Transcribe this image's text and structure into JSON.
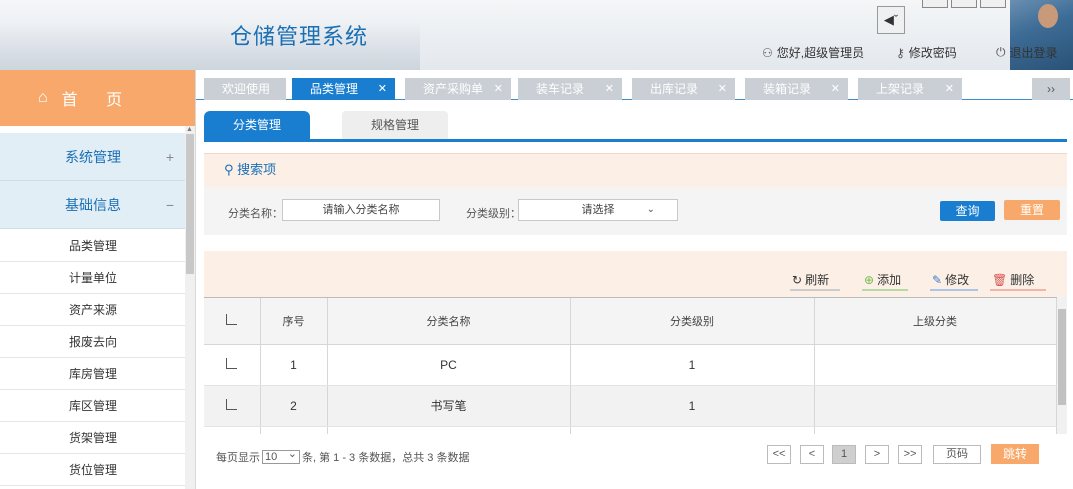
{
  "header": {
    "app_title": "仓储管理系统",
    "user_label": "您好,超级管理员",
    "change_password": "修改密码",
    "logout": "退出登录"
  },
  "sidebar": {
    "home": "首 页",
    "groups": [
      {
        "label": "系统管理",
        "toggle": "+"
      },
      {
        "label": "基础信息",
        "toggle": "−"
      }
    ],
    "items": [
      "品类管理",
      "计量单位",
      "资产来源",
      "报废去向",
      "库房管理",
      "库区管理",
      "货架管理",
      "货位管理"
    ]
  },
  "tabs": [
    {
      "label": "欢迎使用",
      "close": ""
    },
    {
      "label": "品类管理",
      "close": "✕"
    },
    {
      "label": "资产采购单",
      "close": "✕"
    },
    {
      "label": "装车记录",
      "close": "✕"
    },
    {
      "label": "出库记录",
      "close": "✕"
    },
    {
      "label": "装箱记录",
      "close": "✕"
    },
    {
      "label": "上架记录",
      "close": "✕"
    }
  ],
  "tab_next": "››",
  "subtabs": {
    "active": "分类管理",
    "inactive": "规格管理"
  },
  "search": {
    "title": "搜索项",
    "name_label": "分类名称：",
    "name_placeholder": "请输入分类名称",
    "level_label": "分类级别：",
    "level_value": "请选择",
    "query_btn": "查询",
    "reset_btn": "重置"
  },
  "toolbar": {
    "refresh": "刷新",
    "add": "添加",
    "edit": "修改",
    "delete": "删除"
  },
  "table": {
    "headers": [
      "序号",
      "分类名称",
      "分类级别",
      "上级分类"
    ],
    "rows": [
      {
        "no": "1",
        "name": "PC",
        "level": "1",
        "parent": ""
      },
      {
        "no": "2",
        "name": "书写笔",
        "level": "1",
        "parent": ""
      }
    ]
  },
  "pagination": {
    "per_page_prefix": "每页显示",
    "per_page": "10",
    "summary": "条, 第 1 - 3 条数据，总共 3 条数据",
    "first": "<<",
    "prev": "<",
    "current": "1",
    "next": ">",
    "last": ">>",
    "page_input": "页码",
    "go": "跳转"
  },
  "colors": {
    "primary": "#1a7ed0",
    "accent": "#f7a86a",
    "panel": "#fbefe6"
  }
}
